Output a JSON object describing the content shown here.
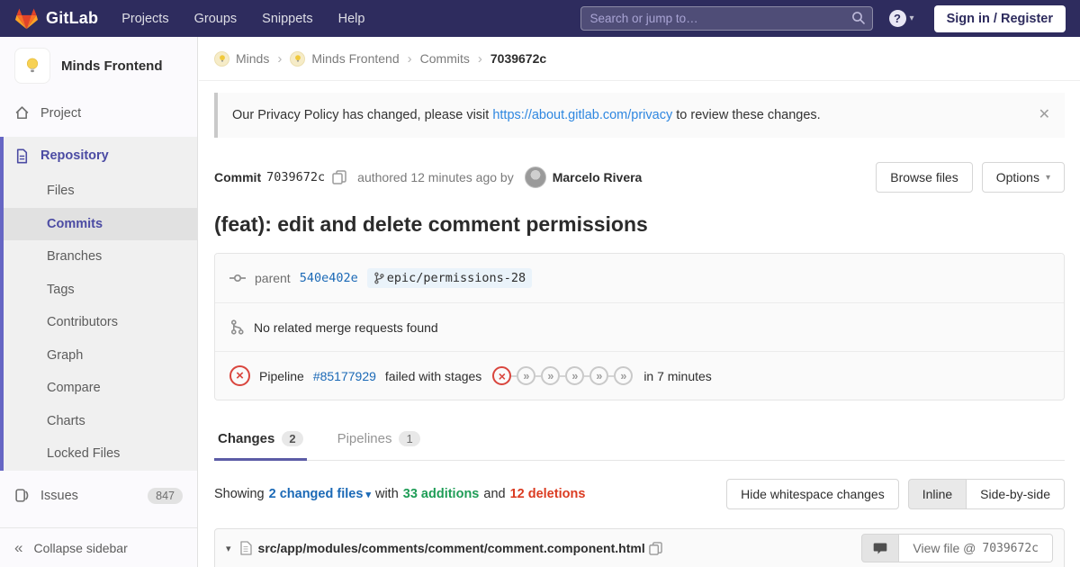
{
  "navbar": {
    "brand": "GitLab",
    "links": [
      "Projects",
      "Groups",
      "Snippets",
      "Help"
    ],
    "search_placeholder": "Search or jump to…",
    "signin_label": "Sign in / Register"
  },
  "sidebar": {
    "project_name": "Minds Frontend",
    "project_item": "Project",
    "repository_label": "Repository",
    "repo_items": [
      "Files",
      "Commits",
      "Branches",
      "Tags",
      "Contributors",
      "Graph",
      "Compare",
      "Charts",
      "Locked Files"
    ],
    "active_repo_item": "Commits",
    "issues_label": "Issues",
    "issues_count": "847",
    "collapse_label": "Collapse sidebar"
  },
  "breadcrumb": {
    "group": "Minds",
    "project": "Minds Frontend",
    "section": "Commits",
    "current": "7039672c"
  },
  "banner": {
    "text_before": "Our Privacy Policy has changed, please visit",
    "link_text": "https://about.gitlab.com/privacy",
    "text_after": "to review these changes."
  },
  "commit": {
    "label": "Commit",
    "sha": "7039672c",
    "authored_text": "authored 12 minutes ago by",
    "author_name": "Marcelo Rivera",
    "browse_files_label": "Browse files",
    "options_label": "Options",
    "title": "(feat): edit and delete comment permissions",
    "parent_label": "parent",
    "parent_sha": "540e402e",
    "ref_name": "epic/permissions-28",
    "merge_request_text": "No related merge requests found",
    "pipeline": {
      "label": "Pipeline",
      "id": "#85177929",
      "status_text": "failed with stages",
      "stages": [
        "failed",
        "skipped",
        "skipped",
        "skipped",
        "skipped",
        "skipped"
      ],
      "duration_text": "in 7 minutes"
    }
  },
  "tabs": [
    {
      "label": "Changes",
      "count": "2",
      "active": true
    },
    {
      "label": "Pipelines",
      "count": "1",
      "active": false
    }
  ],
  "diff_summary": {
    "showing": "Showing",
    "changed_files": "2 changed files",
    "with_text": "with",
    "additions": "33 additions",
    "and_text": "and",
    "deletions": "12 deletions",
    "hide_whitespace_label": "Hide whitespace changes",
    "inline_label": "Inline",
    "side_by_side_label": "Side-by-side"
  },
  "file_header": {
    "path": "src/app/modules/comments/comment/comment.component.html",
    "view_file_prefix": "View file @",
    "view_file_sha": "7039672c"
  },
  "colors": {
    "navbar_bg": "#2e2c5e",
    "accent_indigo": "#4b4ba3",
    "link_blue": "#1b69b6",
    "additions_green": "#1f9d57",
    "deletions_red": "#db3b21",
    "failed_red": "#d9453d",
    "brand_orange": "#fc6d26"
  }
}
